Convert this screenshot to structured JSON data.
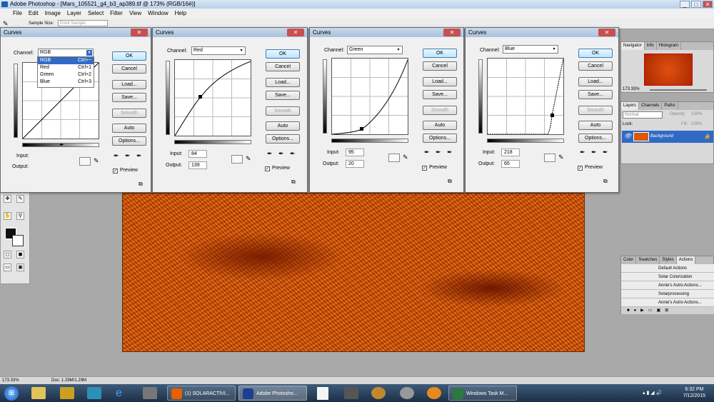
{
  "app": {
    "title": "Adobe Photoshop - [Mars_105521_g4_b3_ap389.tif @ 173% (RGB/16#)]",
    "menus": [
      "File",
      "Edit",
      "Image",
      "Layer",
      "Select",
      "Filter",
      "View",
      "Window",
      "Help"
    ],
    "options": {
      "sample_size_label": "Sample Size:",
      "sample_size_value": "Point Sample"
    }
  },
  "curves_common": {
    "title": "Curves",
    "channel_label": "Channel:",
    "buttons": {
      "ok": "OK",
      "cancel": "Cancel",
      "load": "Load...",
      "save": "Save...",
      "smooth": "Smooth",
      "auto": "Auto",
      "options": "Options..."
    },
    "input_label": "Input:",
    "output_label": "Output:",
    "preview_label": "Preview"
  },
  "dialogs": [
    {
      "channel": "RGB",
      "input": "",
      "output": ""
    },
    {
      "channel": "Red",
      "input": "84",
      "output": "139"
    },
    {
      "channel": "Green",
      "input": "95",
      "output": "20"
    },
    {
      "channel": "Blue",
      "input": "218",
      "output": "65"
    }
  ],
  "channel_dropdown": [
    {
      "name": "RGB",
      "shortcut": "Ctrl+~",
      "selected": true
    },
    {
      "name": "Red",
      "shortcut": "Ctrl+1"
    },
    {
      "name": "Green",
      "shortcut": "Ctrl+2"
    },
    {
      "name": "Blue",
      "shortcut": "Ctrl+3"
    }
  ],
  "navigator": {
    "tabs": [
      "Navigator",
      "Info",
      "Histogram"
    ],
    "zoom": "173.33%"
  },
  "layers": {
    "tabs": [
      "Layers",
      "Channels",
      "Paths"
    ],
    "blend": "Normal",
    "opacity_label": "Opacity:",
    "opacity": "100%",
    "lock_label": "Lock:",
    "fill_label": "Fill:",
    "fill": "100%",
    "layer_name": "Background"
  },
  "actions": {
    "tabs": [
      "Color",
      "Swatches",
      "Styles",
      "Actions"
    ],
    "items": [
      "Default Actions",
      "Solar Colorization",
      "Annie's Astro Actions...",
      "Solarprocessing",
      "Annie's Astro Actions..."
    ]
  },
  "status": {
    "zoom": "173.33%",
    "doc": "Doc: 1.29M/1.29M"
  },
  "taskbar": {
    "items": [
      {
        "label": "(1) SOLARACTIVI...",
        "color": "#e66000"
      },
      {
        "label": "Adobe Photosho...",
        "color": "#1c3f95"
      },
      {
        "label": "Windows Task M...",
        "color": "#2a7a3a"
      }
    ],
    "time": "6:32 PM",
    "date": "7/12/2015"
  },
  "colors": {
    "selection": "#316ac5",
    "canvas": "#d9580a"
  }
}
